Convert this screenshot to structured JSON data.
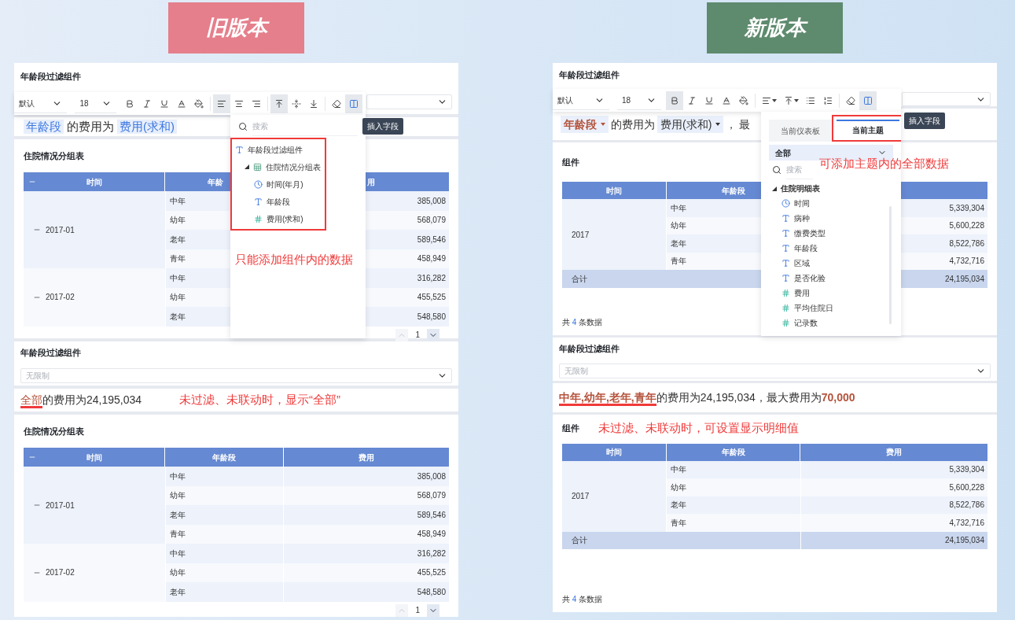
{
  "banners": [
    {
      "label": "旧版本",
      "color": "#e57f8c"
    },
    {
      "label": "新版本",
      "color": "#5e8a6e"
    }
  ],
  "old": {
    "filter_top": {
      "title": "年龄段过滤组件"
    },
    "toolbar": {
      "font": "默认",
      "size": "18",
      "groups": [
        [
          {
            "kind": "bold",
            "selected": false
          },
          {
            "kind": "italic",
            "selected": false
          },
          {
            "kind": "underline",
            "selected": false
          },
          {
            "kind": "font_color",
            "selected": false
          },
          {
            "kind": "fill",
            "selected": false
          }
        ],
        [
          {
            "kind": "align_left",
            "selected": true
          },
          {
            "kind": "align_center",
            "selected": false
          },
          {
            "kind": "align_right",
            "selected": false
          }
        ],
        [
          {
            "kind": "valign_top",
            "selected": true
          },
          {
            "kind": "valign_middle",
            "selected": false
          },
          {
            "kind": "valign_bottom",
            "selected": false
          }
        ],
        [
          {
            "kind": "clear",
            "selected": false
          },
          {
            "kind": "insert",
            "selected": true
          }
        ]
      ]
    },
    "sentence": {
      "field": "年龄段",
      "text": "的费用为",
      "measure": "费用(求和)"
    },
    "popup": {
      "placeholder": "搜索",
      "tree": [
        {
          "label": "年龄段过滤组件",
          "kind": "text",
          "children": [
            {
              "label": "住院情况分组表",
              "kind": "table",
              "expanded": true,
              "children": [
                {
                  "label": "时间(年月)",
                  "kind": "time"
                },
                {
                  "label": "年龄段",
                  "kind": "dimension"
                },
                {
                  "label": "费用(求和)",
                  "kind": "measure"
                }
              ]
            }
          ]
        }
      ],
      "annotation": "只能添加组件内的数据"
    },
    "tooltip": "插入字段",
    "table_top": {
      "title": "住院情况分组表",
      "header_expanded": true,
      "columns": [
        {
          "label": "时间"
        },
        {
          "label": "年龄"
        },
        {
          "label": "用"
        }
      ],
      "groups": [
        {
          "time": "2017-01",
          "expanded": true,
          "rows": [
            {
              "age": "中年",
              "cost": "385,008"
            },
            {
              "age": "幼年",
              "cost": "568,079"
            },
            {
              "age": "老年",
              "cost": "589,546"
            },
            {
              "age": "青年",
              "cost": "458,949"
            }
          ]
        },
        {
          "time": "2017-02",
          "expanded": true,
          "rows": [
            {
              "age": "中年",
              "cost": "316,282"
            },
            {
              "age": "幼年",
              "cost": "455,525"
            },
            {
              "age": "老年",
              "cost": "548,580"
            }
          ]
        }
      ],
      "page": "1"
    },
    "filter_bottom": {
      "title": "年龄段过滤组件",
      "placeholder": "无限制"
    },
    "result": {
      "highlight": "全部",
      "text": "的费用为24,195,034",
      "annotation": "未过滤、未联动时，显示“全部”"
    },
    "table_bottom": {
      "title": "住院情况分组表",
      "header_expanded": true,
      "columns": [
        {
          "label": "时间"
        },
        {
          "label": "年龄段"
        },
        {
          "label": "费用"
        }
      ],
      "groups": [
        {
          "time": "2017-01",
          "expanded": true,
          "rows": [
            {
              "age": "中年",
              "cost": "385,008"
            },
            {
              "age": "幼年",
              "cost": "568,079"
            },
            {
              "age": "老年",
              "cost": "589,546"
            },
            {
              "age": "青年",
              "cost": "458,949"
            }
          ]
        },
        {
          "time": "2017-02",
          "expanded": true,
          "rows": [
            {
              "age": "中年",
              "cost": "316,282"
            },
            {
              "age": "幼年",
              "cost": "455,525"
            },
            {
              "age": "老年",
              "cost": "548,580"
            }
          ]
        }
      ],
      "page": "1"
    }
  },
  "new": {
    "filter_top": {
      "title": "年龄段过滤组件"
    },
    "toolbar": {
      "font": "默认",
      "size": "18",
      "groups": [
        [
          {
            "kind": "bold",
            "selected": true
          },
          {
            "kind": "italic",
            "selected": false
          },
          {
            "kind": "underline",
            "selected": false
          },
          {
            "kind": "font_color",
            "selected": false
          },
          {
            "kind": "fill",
            "selected": false
          }
        ],
        [
          {
            "kind": "align_menu",
            "selected": false
          },
          {
            "kind": "valign_menu",
            "selected": false
          },
          {
            "kind": "bullet_list",
            "selected": false
          },
          {
            "kind": "number_list",
            "selected": false
          }
        ],
        [
          {
            "kind": "clear",
            "selected": false
          },
          {
            "kind": "insert",
            "selected": true
          }
        ]
      ]
    },
    "sentence": {
      "field": "年龄段",
      "text": "的费用为",
      "measure": "费用(求和)",
      "separator": "，",
      "tail": "最"
    },
    "popup": {
      "tabs": [
        {
          "label": "当前仪表板",
          "selected": false
        },
        {
          "label": "当前主题",
          "selected": true
        }
      ],
      "scope": "全部",
      "placeholder": "搜索",
      "tree": [
        {
          "label": "住院明细表",
          "expanded": true,
          "children": [
            {
              "label": "时间",
              "kind": "time"
            },
            {
              "label": "病种",
              "kind": "dimension"
            },
            {
              "label": "缴费类型",
              "kind": "dimension"
            },
            {
              "label": "年龄段",
              "kind": "dimension"
            },
            {
              "label": "区域",
              "kind": "dimension"
            },
            {
              "label": "是否化验",
              "kind": "dimension"
            },
            {
              "label": "费用",
              "kind": "measure"
            },
            {
              "label": "平均住院日",
              "kind": "measure"
            },
            {
              "label": "记录数",
              "kind": "count"
            }
          ]
        }
      ],
      "annotation": "可添加主题内的全部数据"
    },
    "tooltip": "插入字段",
    "table_top": {
      "title": "组件",
      "columns": [
        {
          "label": "时间"
        },
        {
          "label": "年龄段"
        }
      ],
      "groups": [
        {
          "time": "2017",
          "rows": [
            {
              "age": "中年",
              "cost": "5,339,304"
            },
            {
              "age": "幼年",
              "cost": "5,600,228"
            },
            {
              "age": "老年",
              "cost": "8,522,786"
            },
            {
              "age": "青年",
              "cost": "4,732,716"
            }
          ]
        }
      ],
      "total": {
        "label": "合计",
        "value": "24,195,034"
      },
      "count": {
        "prefix": "共",
        "number": "4",
        "suffix": "条数据"
      }
    },
    "filter_bottom": {
      "title": "年龄段过滤组件",
      "placeholder": "无限制"
    },
    "result": {
      "values": "中年,幼年,老年,青年",
      "text": "的费用为24,195,034，最大费用为",
      "max": "70,000"
    },
    "table_bottom": {
      "title": "组件",
      "annotation": "未过滤、未联动时，可设置显示明细值",
      "columns": [
        {
          "label": "时间"
        },
        {
          "label": "年龄段"
        },
        {
          "label": "费用"
        }
      ],
      "groups": [
        {
          "time": "2017",
          "rows": [
            {
              "age": "中年",
              "cost": "5,339,304"
            },
            {
              "age": "幼年",
              "cost": "5,600,228"
            },
            {
              "age": "老年",
              "cost": "8,522,786"
            },
            {
              "age": "青年",
              "cost": "4,732,716"
            }
          ]
        }
      ],
      "total": {
        "label": "合计",
        "value": "24,195,034"
      },
      "count": {
        "prefix": "共",
        "number": "4",
        "suffix": "条数据"
      }
    }
  }
}
